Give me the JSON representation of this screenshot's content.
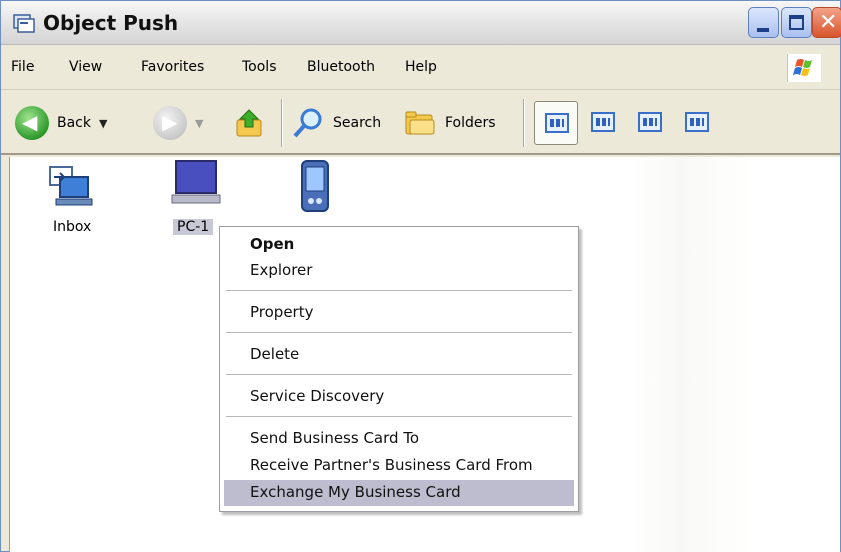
{
  "window": {
    "title": "Object Push",
    "title_icon": "folder-window-icon",
    "buttons": [
      "minimize",
      "maximize",
      "close"
    ],
    "close_glyph": "✕"
  },
  "menubar": {
    "items": [
      "File",
      "View",
      "Favorites",
      "Tools",
      "Bluetooth",
      "Help"
    ],
    "logo_icon": "windows-flag-icon"
  },
  "toolbar": {
    "back_label": "Back",
    "back_arrow": "◀",
    "forward_arrow": "▶",
    "caret": "▼",
    "search_label": "Search",
    "folders_label": "Folders",
    "views": [
      "thumbnails-view",
      "tiles-view",
      "icons-view",
      "details-view"
    ],
    "accent_color": "#2f5fbf"
  },
  "files": [
    {
      "label": "Inbox",
      "icon": "inbox-computer-icon"
    },
    {
      "label": "PC-1",
      "icon": "laptop-icon",
      "selected": true
    },
    {
      "label": "",
      "icon": "pda-device-icon"
    }
  ],
  "context_menu": {
    "items": [
      {
        "label": "Open",
        "bold": true
      },
      {
        "label": "Explorer"
      },
      {
        "label": "Property"
      },
      {
        "label": "Delete"
      },
      {
        "label": "Service Discovery"
      },
      {
        "label": "Send Business Card To"
      },
      {
        "label": "Receive Partner's Business Card From"
      },
      {
        "label": "Exchange My Business Card",
        "highlighted": true
      }
    ],
    "highlight_color": "#bdbdcf"
  }
}
